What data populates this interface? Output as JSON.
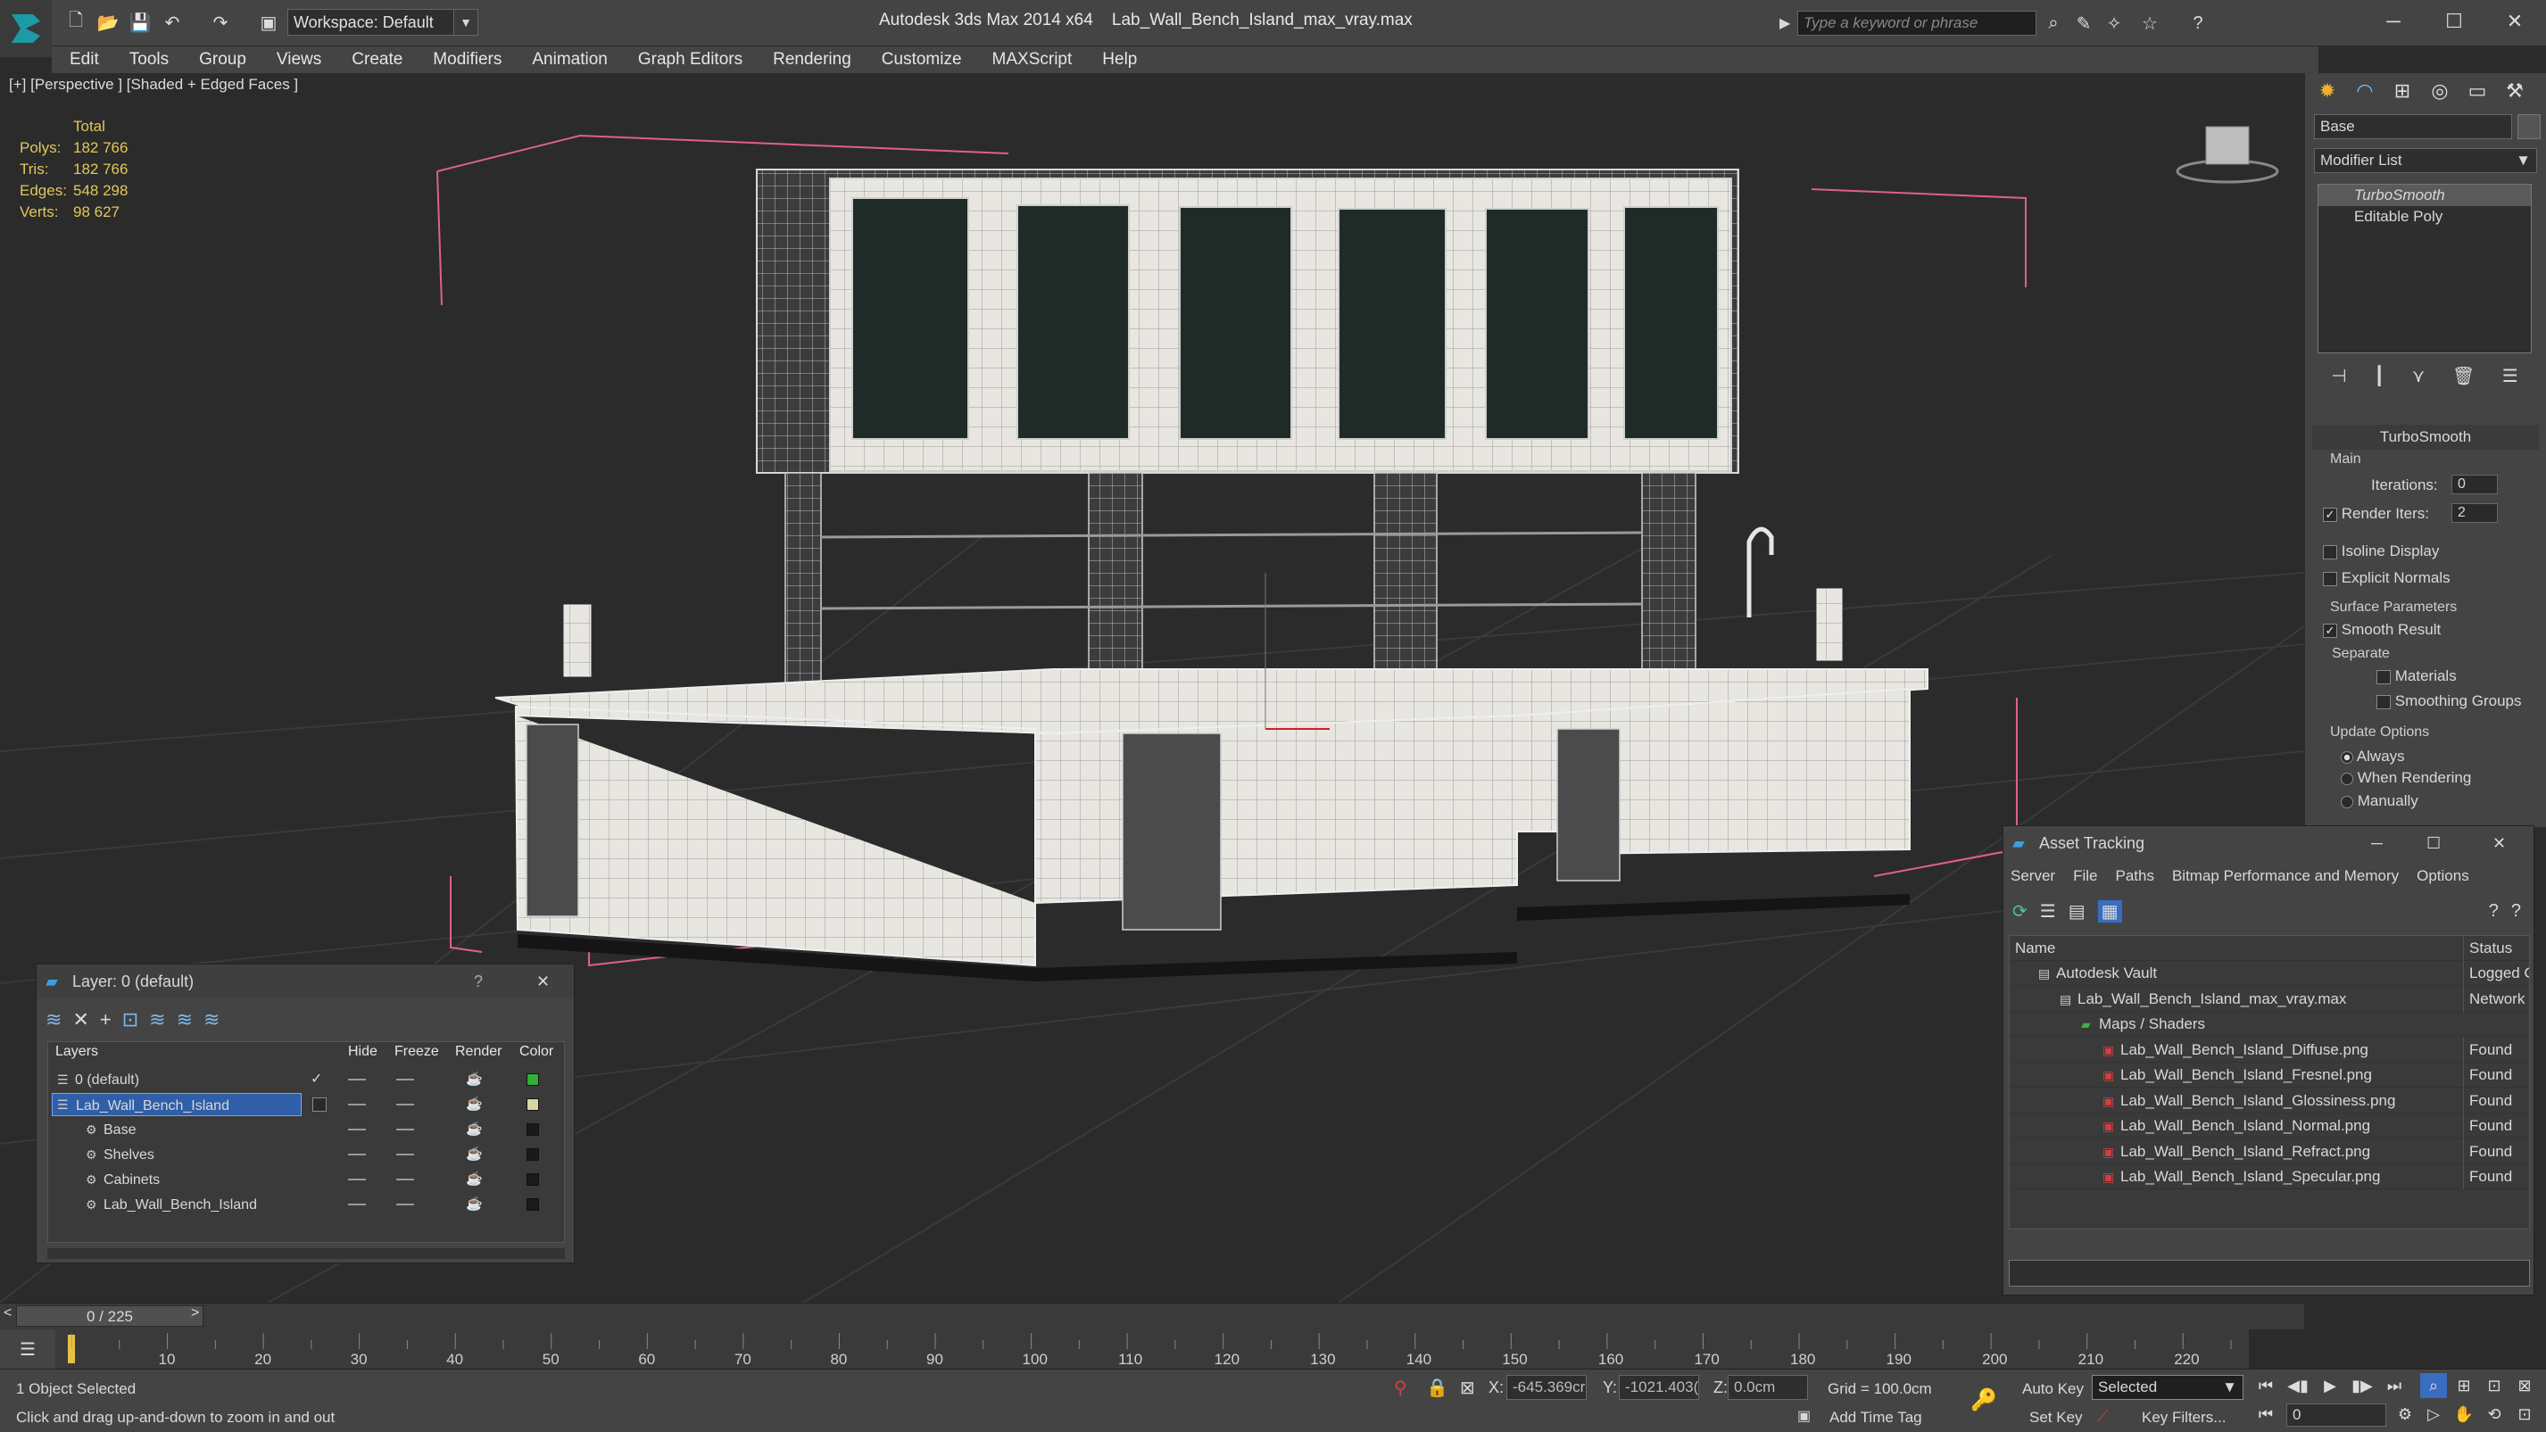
{
  "title_bar": {
    "app_title": "Autodesk 3ds Max  2014 x64",
    "file_name": "Lab_Wall_Bench_Island_max_vray.max",
    "workspace_label": "Workspace: Default",
    "search_placeholder": "Type a keyword or phrase"
  },
  "menu": [
    "Edit",
    "Tools",
    "Group",
    "Views",
    "Create",
    "Modifiers",
    "Animation",
    "Graph Editors",
    "Rendering",
    "Customize",
    "MAXScript",
    "Help"
  ],
  "viewport": {
    "label": "[+] [Perspective ] [Shaded + Edged Faces ]",
    "stats_header": "Total",
    "stats": [
      {
        "label": "Polys:",
        "value": "182 766"
      },
      {
        "label": "Tris:",
        "value": "182 766"
      },
      {
        "label": "Edges:",
        "value": "548 298"
      },
      {
        "label": "Verts:",
        "value": "98 627"
      }
    ]
  },
  "command_panel": {
    "object_name": "Base",
    "modifier_list": "Modifier List",
    "stack": [
      "TurboSmooth",
      "Editable Poly"
    ],
    "rollout_title": "TurboSmooth",
    "main_group": "Main",
    "iterations_label": "Iterations:",
    "iterations_value": "0",
    "render_iters_label": "Render Iters:",
    "render_iters_value": "2",
    "isoline_label": "Isoline Display",
    "explicit_label": "Explicit Normals",
    "surface_group": "Surface Parameters",
    "smooth_result_label": "Smooth Result",
    "separate_label": "Separate",
    "materials_label": "Materials",
    "smoothing_groups_label": "Smoothing Groups",
    "update_group": "Update Options",
    "always_label": "Always",
    "when_rendering_label": "When Rendering",
    "manually_label": "Manually"
  },
  "layer_window": {
    "title": "Layer: 0 (default)",
    "help": "?",
    "columns": {
      "layers": "Layers",
      "hide": "Hide",
      "freeze": "Freeze",
      "render": "Render",
      "color": "Color"
    },
    "rows": [
      {
        "name": "0 (default)",
        "indent": 0,
        "selected": false,
        "color": "#2fae3a"
      },
      {
        "name": "Lab_Wall_Bench_Island",
        "indent": 0,
        "selected": true,
        "color": "#d8d6a0"
      },
      {
        "name": "Base",
        "indent": 1,
        "selected": false,
        "color": "#1a1a1a"
      },
      {
        "name": "Shelves",
        "indent": 1,
        "selected": false,
        "color": "#1a1a1a"
      },
      {
        "name": "Cabinets",
        "indent": 1,
        "selected": false,
        "color": "#1a1a1a"
      },
      {
        "name": "Lab_Wall_Bench_Island",
        "indent": 1,
        "selected": false,
        "color": "#1a1a1a"
      }
    ]
  },
  "asset_window": {
    "title": "Asset Tracking",
    "menu": [
      "Server",
      "File",
      "Paths",
      "Bitmap Performance and Memory",
      "Options"
    ],
    "col_name": "Name",
    "col_status": "Status",
    "rows": [
      {
        "name": "Autodesk Vault",
        "status": "Logged O",
        "indent": 1
      },
      {
        "name": "Lab_Wall_Bench_Island_max_vray.max",
        "status": "Network I",
        "indent": 2
      },
      {
        "name": "Maps / Shaders",
        "status": "",
        "indent": 3
      },
      {
        "name": "Lab_Wall_Bench_Island_Diffuse.png",
        "status": "Found",
        "indent": 4
      },
      {
        "name": "Lab_Wall_Bench_Island_Fresnel.png",
        "status": "Found",
        "indent": 4
      },
      {
        "name": "Lab_Wall_Bench_Island_Glossiness.png",
        "status": "Found",
        "indent": 4
      },
      {
        "name": "Lab_Wall_Bench_Island_Normal.png",
        "status": "Found",
        "indent": 4
      },
      {
        "name": "Lab_Wall_Bench_Island_Refract.png",
        "status": "Found",
        "indent": 4
      },
      {
        "name": "Lab_Wall_Bench_Island_Specular.png",
        "status": "Found",
        "indent": 4
      }
    ]
  },
  "timeline": {
    "slider_label": "0 / 225",
    "ticks": [
      "10",
      "20",
      "30",
      "40",
      "50",
      "60",
      "70",
      "80",
      "90",
      "100",
      "110",
      "120",
      "130",
      "140",
      "150",
      "160",
      "170",
      "180",
      "190",
      "200",
      "210",
      "220"
    ]
  },
  "status": {
    "selection": "1 Object Selected",
    "prompt": "Click and drag up-and-down to zoom in and out",
    "x_label": "X:",
    "x_value": "-645.369cr",
    "y_label": "Y:",
    "y_value": "-1021.403(",
    "z_label": "Z:",
    "z_value": "0.0cm",
    "grid": "Grid = 100.0cm",
    "add_time_tag": "Add Time Tag",
    "auto_key": "Auto Key",
    "set_key": "Set Key",
    "selected_dropdown": "Selected",
    "key_filters": "Key Filters...",
    "frame_value": "0"
  }
}
